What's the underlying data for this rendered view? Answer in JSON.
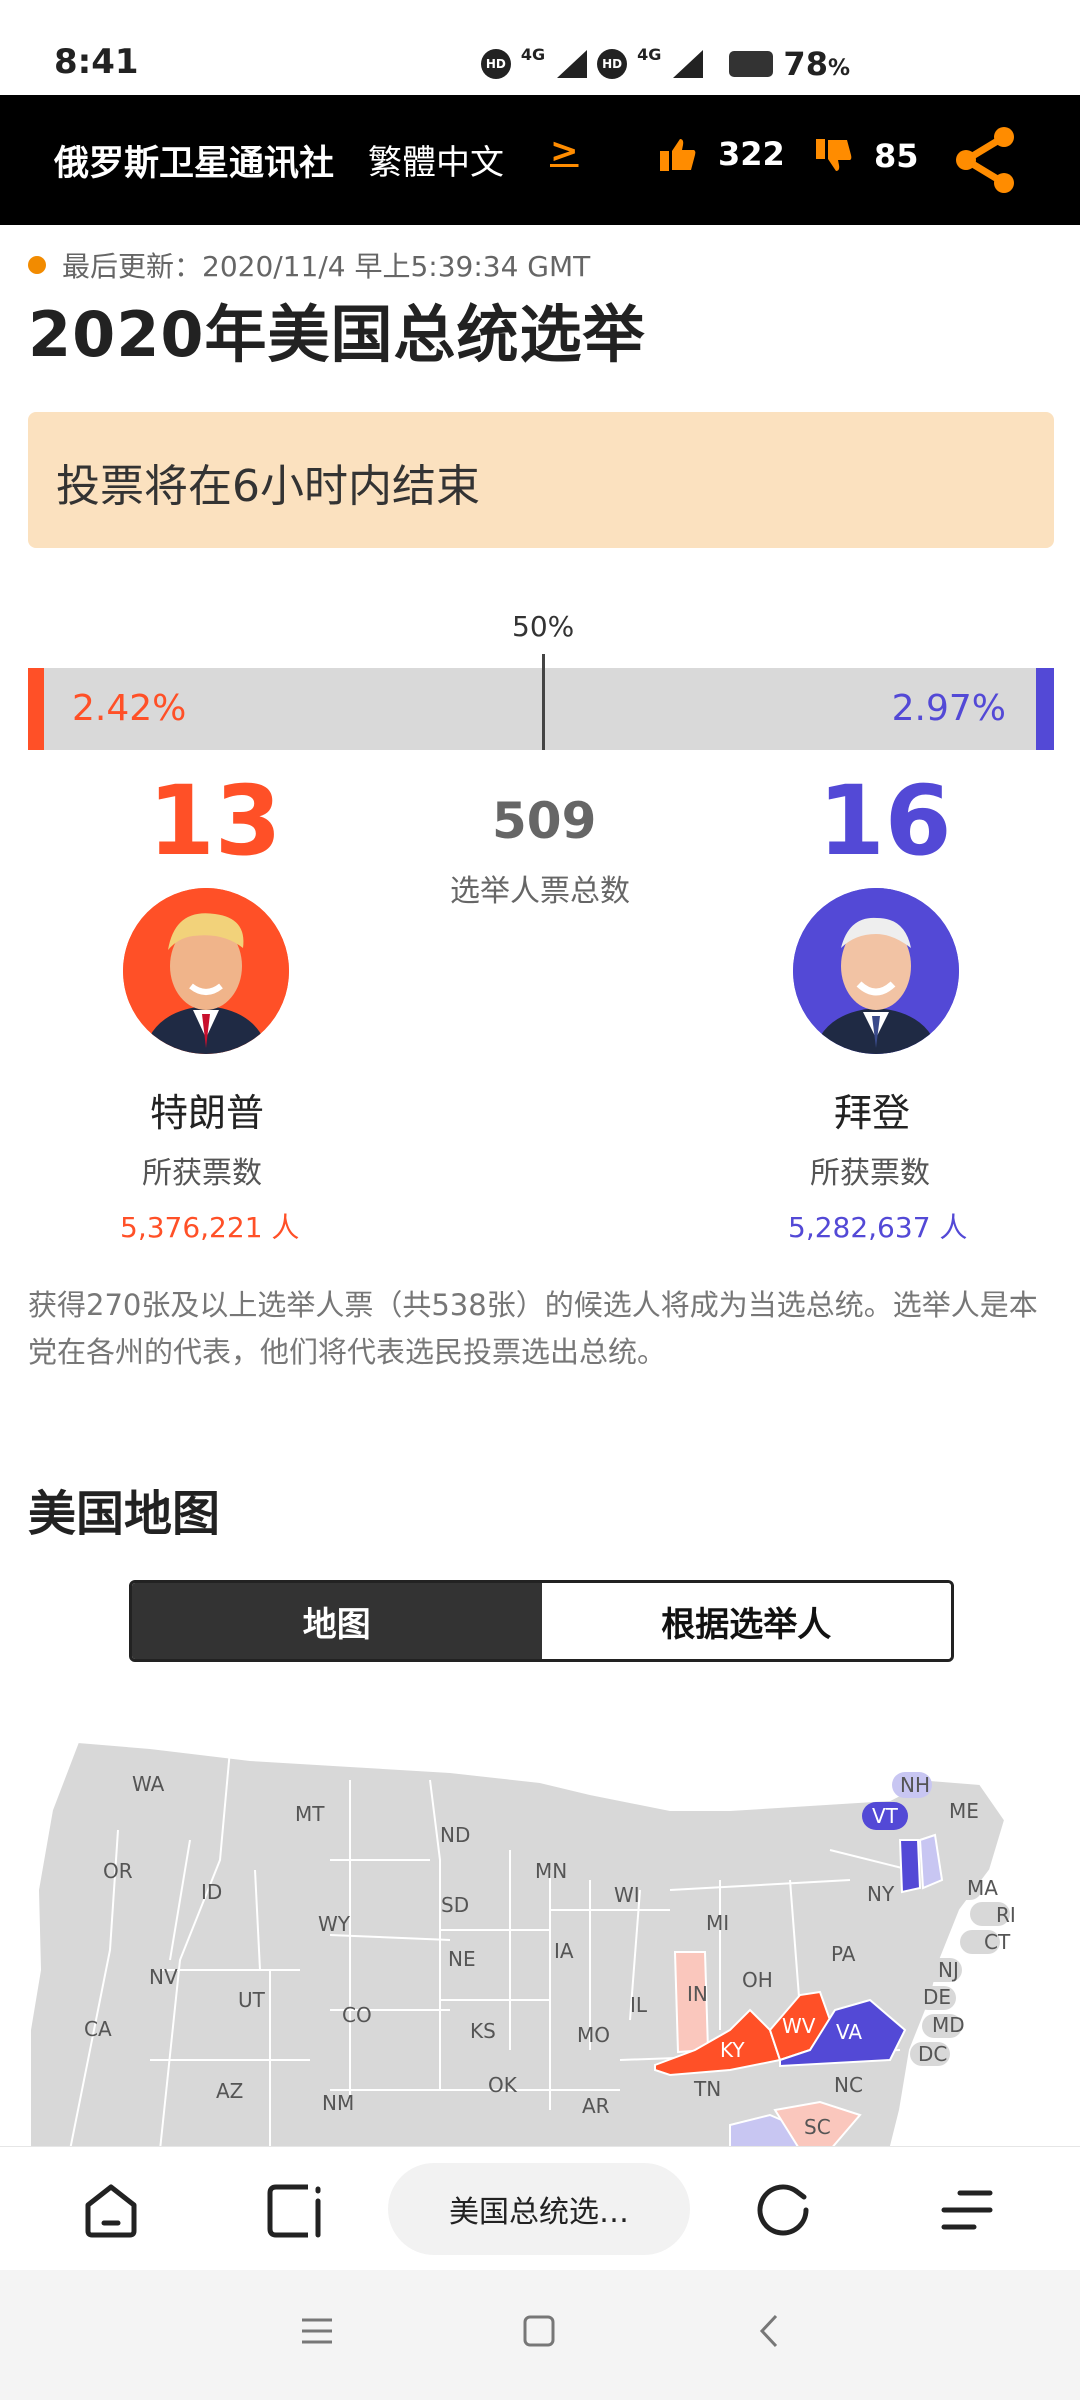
{
  "status_bar": {
    "time": "8:41",
    "hd": "HD",
    "network": "4G",
    "battery": "78",
    "battery_unit": "%"
  },
  "header": {
    "brand": "俄罗斯卫星通讯社",
    "language": "繁體中文",
    "language_link": ">",
    "likes": "322",
    "dislikes": "85",
    "icons": {
      "like": "thumbs-up-icon",
      "dislike": "thumbs-down-icon",
      "share": "share-icon"
    },
    "accent": "#ff8c00"
  },
  "article": {
    "updated": "最后更新：2020/11/4 早上5:39:34 GMT",
    "title": "2020年美国总统选举",
    "notice": "投票将在6小时内结束"
  },
  "results": {
    "midpoint_label": "50%",
    "trump_pct": "2.42%",
    "biden_pct": "2.97%",
    "trump_pct_value": 0.0242,
    "biden_pct_value": 0.0297,
    "trump_ev": "13",
    "biden_ev": "16",
    "total_ev": "509",
    "total_ev_label": "选举人票总数",
    "trump_name": "特朗普",
    "biden_name": "拜登",
    "votes_label": "所获票数",
    "trump_votes": "5,376,221 人",
    "biden_votes": "5,282,637 人",
    "trump_color": "#ff5027",
    "biden_color": "#5349d6"
  },
  "description": "获得270张及以上选举人票（共538张）的候选人将成为当选总统。选举人是本党在各州的代表，他们将代表选民投票选出总统。",
  "map_section": {
    "title": "美国地图",
    "tabs": [
      "地图",
      "根据选举人"
    ],
    "states": [
      "WA",
      "MT",
      "ND",
      "MN",
      "OR",
      "ID",
      "SD",
      "WI",
      "MI",
      "WY",
      "NY",
      "NE",
      "IA",
      "PA",
      "NV",
      "UT",
      "IL",
      "IN",
      "OH",
      "CO",
      "KS",
      "MO",
      "CA",
      "KY",
      "WV",
      "VA",
      "AZ",
      "NM",
      "OK",
      "AR",
      "TN",
      "NC",
      "SC",
      "NH",
      "VT",
      "ME",
      "MA",
      "RI",
      "CT",
      "NJ",
      "DE",
      "MD",
      "DC"
    ]
  },
  "browser": {
    "tab_title": "美国总统选…"
  }
}
